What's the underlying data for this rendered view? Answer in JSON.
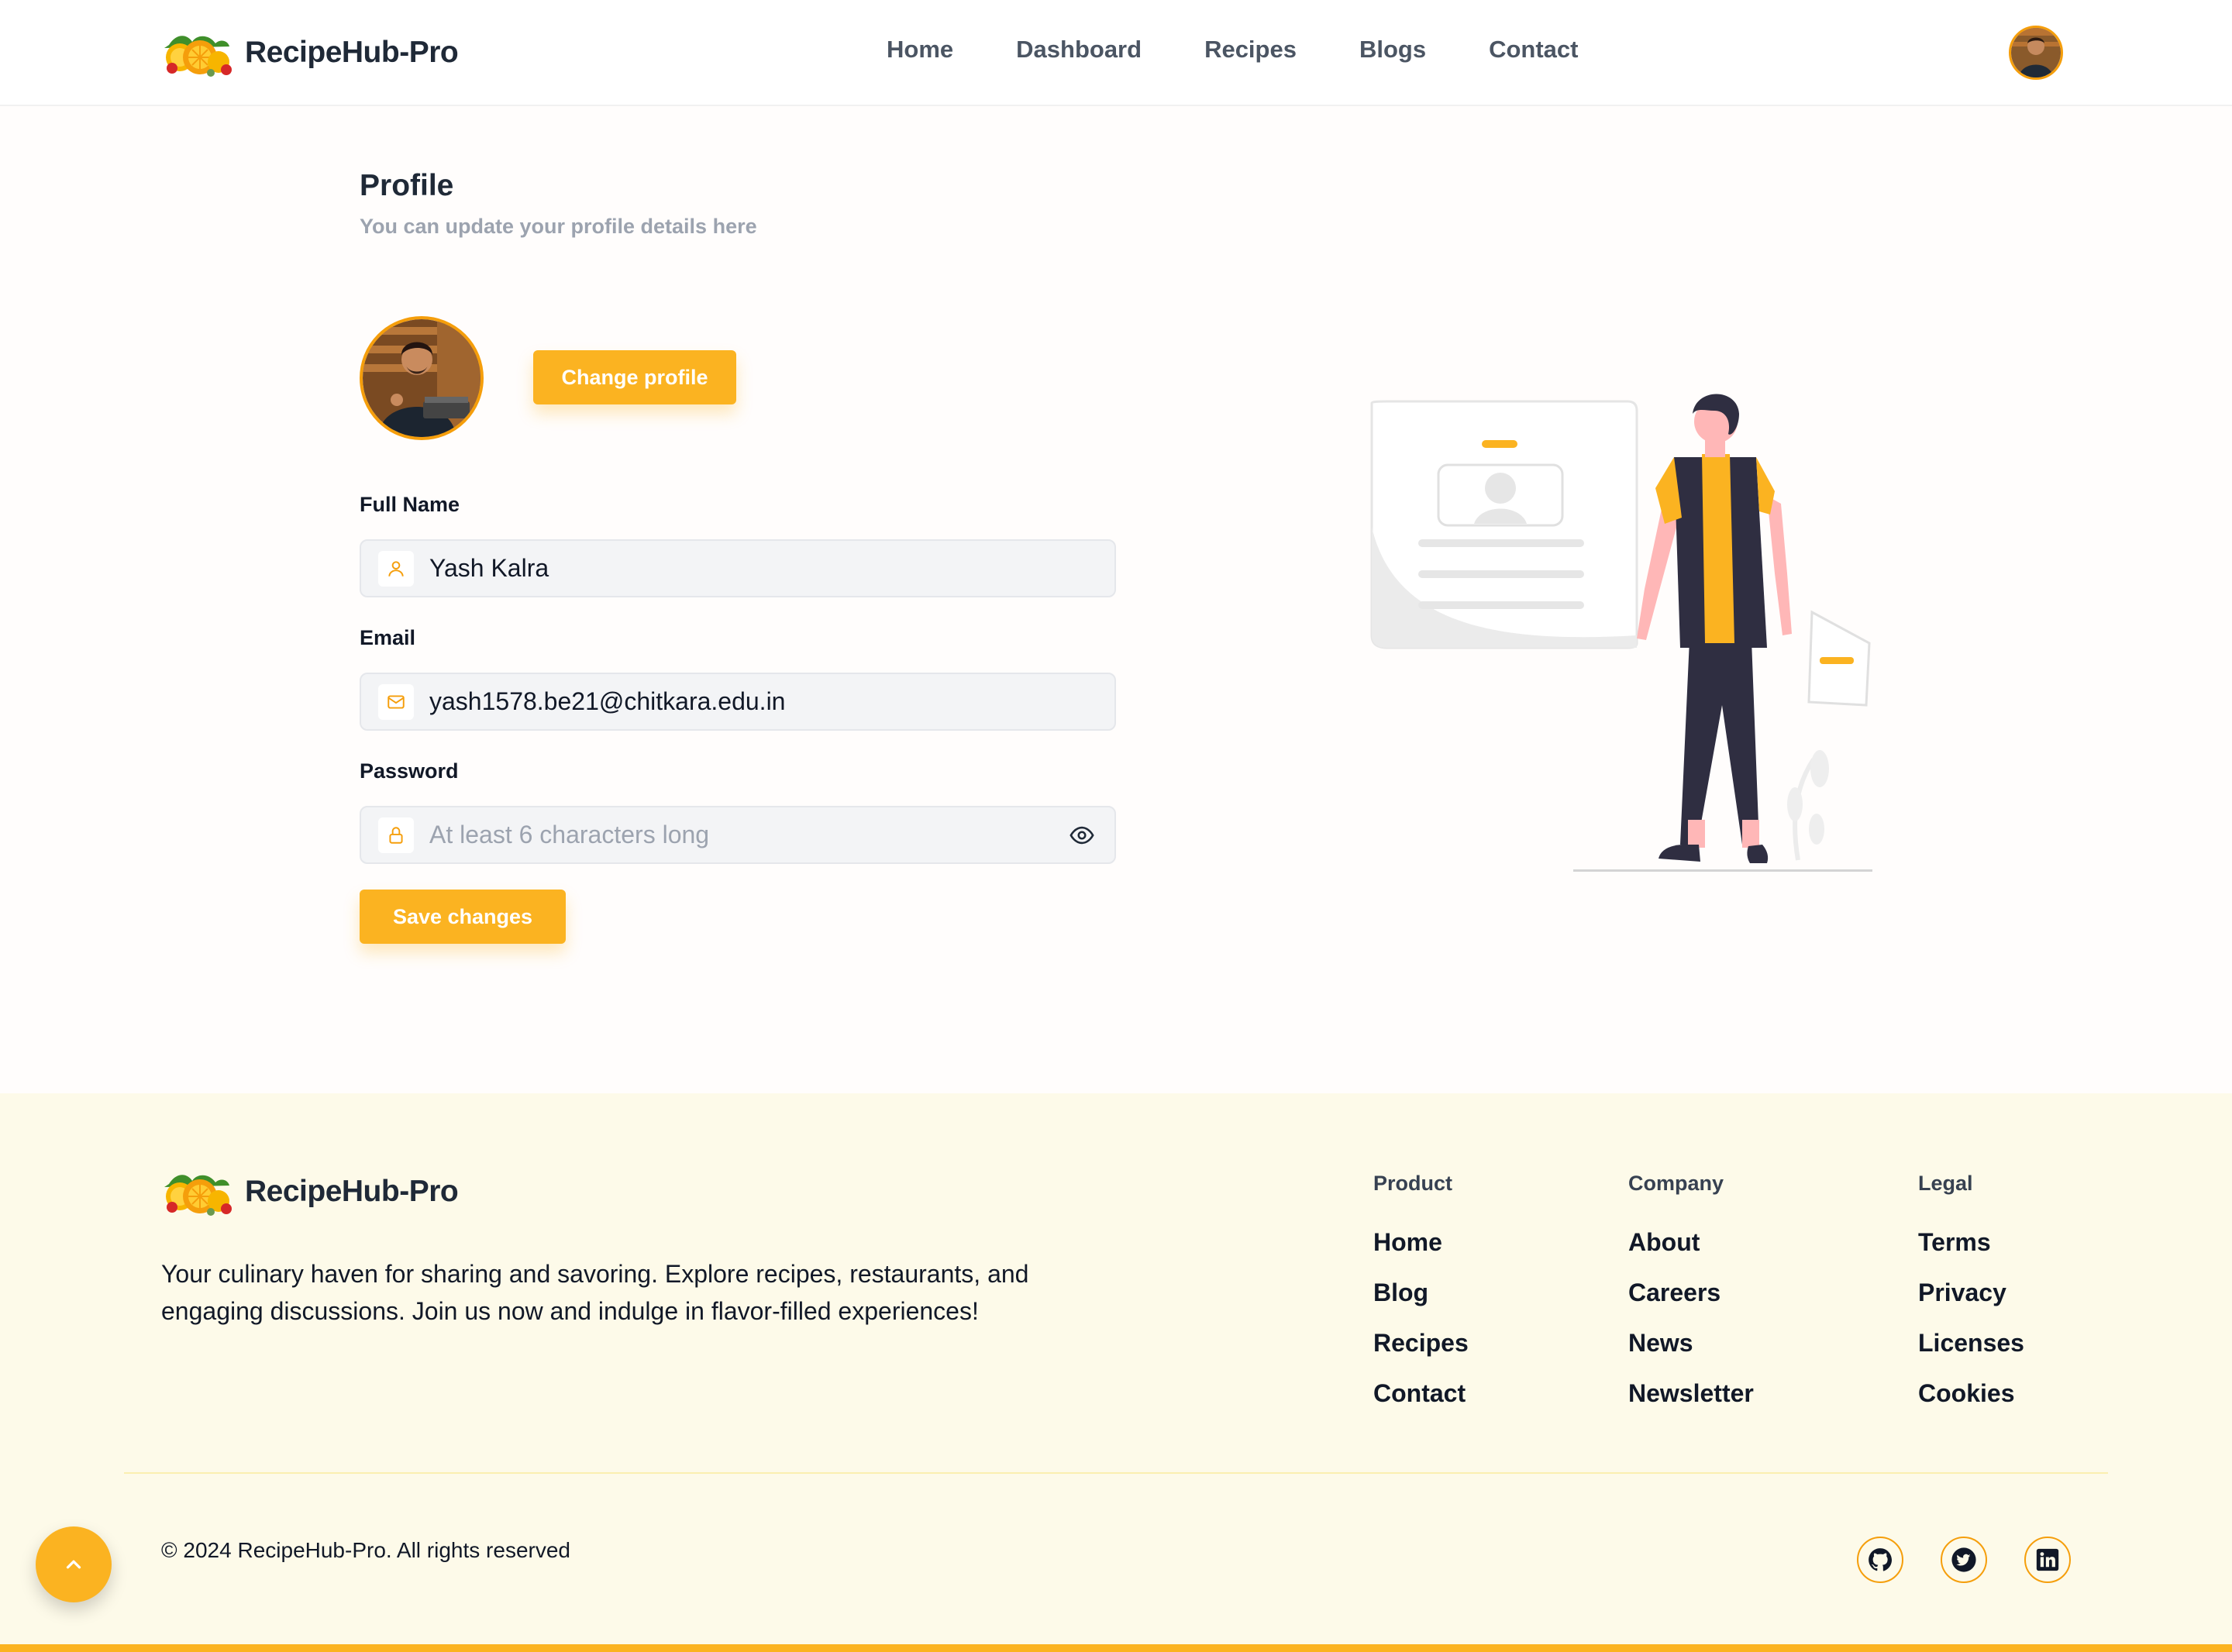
{
  "header": {
    "brand": "RecipeHub-Pro",
    "nav": [
      "Home",
      "Dashboard",
      "Recipes",
      "Blogs",
      "Contact"
    ]
  },
  "profile": {
    "title": "Profile",
    "subtitle": "You can update your profile details here",
    "change_button": "Change profile",
    "full_name_label": "Full Name",
    "full_name_value": "Yash Kalra",
    "email_label": "Email",
    "email_value": "yash1578.be21@chitkara.edu.in",
    "password_label": "Password",
    "password_placeholder": "At least 6 characters long",
    "save_button": "Save changes"
  },
  "footer": {
    "brand": "RecipeHub-Pro",
    "description": "Your culinary haven for sharing and savoring. Explore recipes, restaurants, and engaging discussions. Join us now and indulge in flavor-filled experiences!",
    "columns": [
      {
        "title": "Product",
        "links": [
          "Home",
          "Blog",
          "Recipes",
          "Contact"
        ]
      },
      {
        "title": "Company",
        "links": [
          "About",
          "Careers",
          "News",
          "Newsletter"
        ]
      },
      {
        "title": "Legal",
        "links": [
          "Terms",
          "Privacy",
          "Licenses",
          "Cookies"
        ]
      }
    ],
    "copyright": "© 2024 RecipeHub-Pro. All rights reserved",
    "social": [
      "github-icon",
      "twitter-icon",
      "linkedin-icon"
    ]
  },
  "colors": {
    "accent": "#fbb321",
    "accent_dark": "#f59e0b",
    "footer_bg": "#fdfae9",
    "text_dark": "#1f2937",
    "text_muted": "#9ca3af"
  }
}
